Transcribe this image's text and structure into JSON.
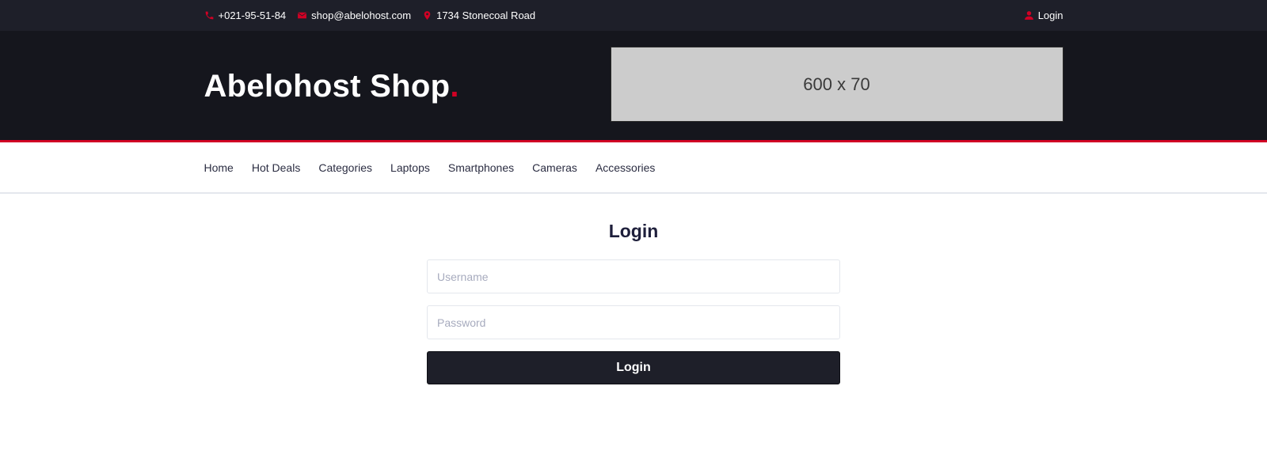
{
  "topbar": {
    "phone": "+021-95-51-84",
    "email": "shop@abelohost.com",
    "address": "1734 Stonecoal Road",
    "login_label": "Login",
    "icons": {
      "phone": "phone-icon",
      "email": "envelope-icon",
      "address": "map-marker-icon",
      "login": "user-icon"
    }
  },
  "header": {
    "logo_text": "Abelohost Shop",
    "logo_dot": ".",
    "banner_text": "600 x 70"
  },
  "nav": {
    "items": [
      "Home",
      "Hot Deals",
      "Categories",
      "Laptops",
      "Smartphones",
      "Cameras",
      "Accessories"
    ]
  },
  "login": {
    "title": "Login",
    "username_placeholder": "Username",
    "password_placeholder": "Password",
    "submit_label": "Login"
  },
  "colors": {
    "accent": "#d10024",
    "topbar_bg": "#1e1f29",
    "header_bg": "#15161d",
    "button_bg": "#1e1f29"
  }
}
